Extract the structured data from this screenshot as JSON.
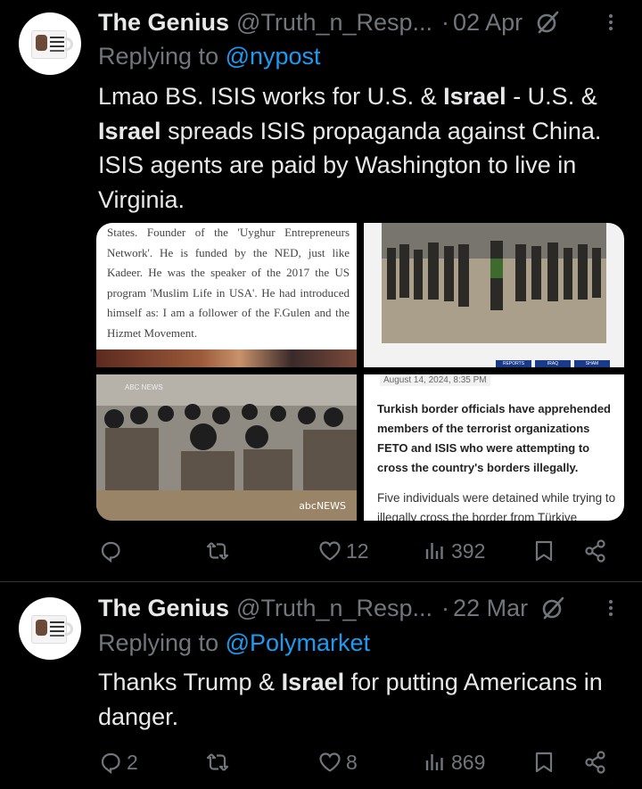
{
  "tweets": [
    {
      "name": "The Genius",
      "handle": "@Truth_n_Resp...",
      "separator": "·",
      "date": "02 Apr",
      "reply_prefix": "Replying to ",
      "reply_mention": "@nypost",
      "text_parts": [
        "Lmao BS. ISIS works for U.S. & ",
        "Israel",
        " - U.S. & ",
        "Israel",
        " spreads ISIS propaganda against China. ISIS agents are paid by Washington to live in Virginia."
      ],
      "media": {
        "article_text": "States. Founder of the 'Uyghur Entrepreneurs Network'. He is funded by the NED, just like Kadeer. He was the speaker of the 2017 the US program 'Muslim Life in USA'. He had introduced himself as: I am a follower of the F.Gulen and the Hizmet Movement.",
        "photo2_tags": [
          "REPORTS",
          "IRAQ",
          "SHAM"
        ],
        "photo3_logo": "abcNEWS",
        "photo3_tag": "ABC NEWS",
        "news_stamp": "August 14, 2024, 8:35 PM",
        "news_headline": "Turkish border officials have apprehended members of the terrorist organizations FETO and ISIS who were attempting to cross the country's borders illegally.",
        "news_sub": "Five individuals were detained while trying to illegally cross the border from Türkiye"
      },
      "actions": {
        "replies": "",
        "reposts": "",
        "likes": "12",
        "views": "392"
      }
    },
    {
      "name": "The Genius",
      "handle": "@Truth_n_Resp...",
      "separator": "·",
      "date": "22 Mar",
      "reply_prefix": "Replying to ",
      "reply_mention": "@Polymarket",
      "text_parts": [
        "Thanks Trump & ",
        "Israel",
        " for putting Americans in danger."
      ],
      "actions": {
        "replies": "2",
        "reposts": "",
        "likes": "8",
        "views": "869"
      }
    }
  ],
  "colors": {
    "background": "#000000",
    "text": "#e7e9ea",
    "muted": "#71767b",
    "link": "#1d9bf0",
    "divider": "#2f3336"
  },
  "icons": [
    "reply-icon",
    "repost-icon",
    "like-icon",
    "views-icon",
    "bookmark-icon",
    "share-icon",
    "grok-icon",
    "more-icon"
  ]
}
